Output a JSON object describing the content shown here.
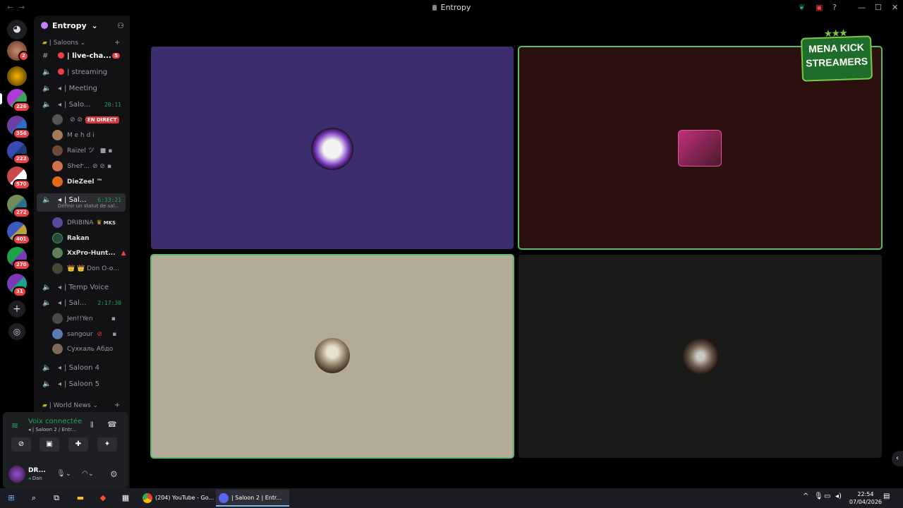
{
  "window": {
    "title": "Entropy",
    "nav_back": "←",
    "nav_forward": "→",
    "controls": [
      "—",
      "☐",
      "✕"
    ],
    "help": "?"
  },
  "rail": {
    "badges": [
      "2",
      "226",
      "356",
      "222",
      "570",
      "272",
      "401",
      "270",
      "31"
    ],
    "add_server": "+",
    "discover": "◎"
  },
  "sidebar": {
    "server_name": "Entropy",
    "server_chevron": "⌄",
    "categories": [
      {
        "label": "| Saloons ⌄"
      },
      {
        "label": "| World News ⌄"
      }
    ],
    "category_add": "+",
    "channels": {
      "live_chat": {
        "label": "| live-cha...",
        "unread": "5"
      },
      "streaming": {
        "label": "| streaming"
      },
      "meeting": {
        "label": "| Meeting"
      },
      "saloon1": {
        "label": "| Salo...",
        "time": "20:11"
      },
      "saloon2": {
        "label": "| Sal...",
        "time": "6:33:21",
        "status": "Définir un statut de sal..."
      },
      "temp_voice": {
        "label": "| Temp Voice"
      },
      "saloon3": {
        "label": "| Sal...",
        "time": "2:17:30"
      },
      "saloon4": {
        "label": "| Saloon 4"
      },
      "saloon5": {
        "label": "| Saloon 5"
      }
    },
    "users": {
      "saloon1": [
        {
          "name": "",
          "live": "EN DIRECT"
        },
        {
          "name": "M e h d i"
        },
        {
          "name": "Raizel ツ"
        },
        {
          "name": "ՏհҽՒ..."
        },
        {
          "name": "DieZeel ™"
        }
      ],
      "saloon2": [
        {
          "name": "DRIBINA",
          "tag": "MKS"
        },
        {
          "name": "Rakan"
        },
        {
          "name": "XxPro-Hunt..."
        },
        {
          "name": "👑 👑 Don O-o..."
        }
      ],
      "saloon3": [
        {
          "name": "Jen!!Yen"
        },
        {
          "name": "sangour"
        },
        {
          "name": "Сухкаль Абдо"
        }
      ]
    }
  },
  "voice_panel": {
    "status": "Voix connectée",
    "channel": "| Saloon 2 / Entr...",
    "user_name": "DR...",
    "user_sub": "Dan"
  },
  "overlay": {
    "line1": "MENA KICK",
    "line2": "STREAMERS",
    "stars": "★★★"
  },
  "taskbar": {
    "apps": [
      {
        "label": "(204) YouTube - Go..."
      },
      {
        "label": "| Saloon 2 | Entr..."
      }
    ],
    "time": "22:54",
    "date": "07/04/2026"
  },
  "colors": {
    "tile1": "#3c2d6e",
    "tile2": "#2c0f0f",
    "tile3": "#b3ab98",
    "tile4": "#1a1a18",
    "speaking": "#57b969",
    "live_red": "#da373c",
    "voice_green": "#23a55a"
  }
}
